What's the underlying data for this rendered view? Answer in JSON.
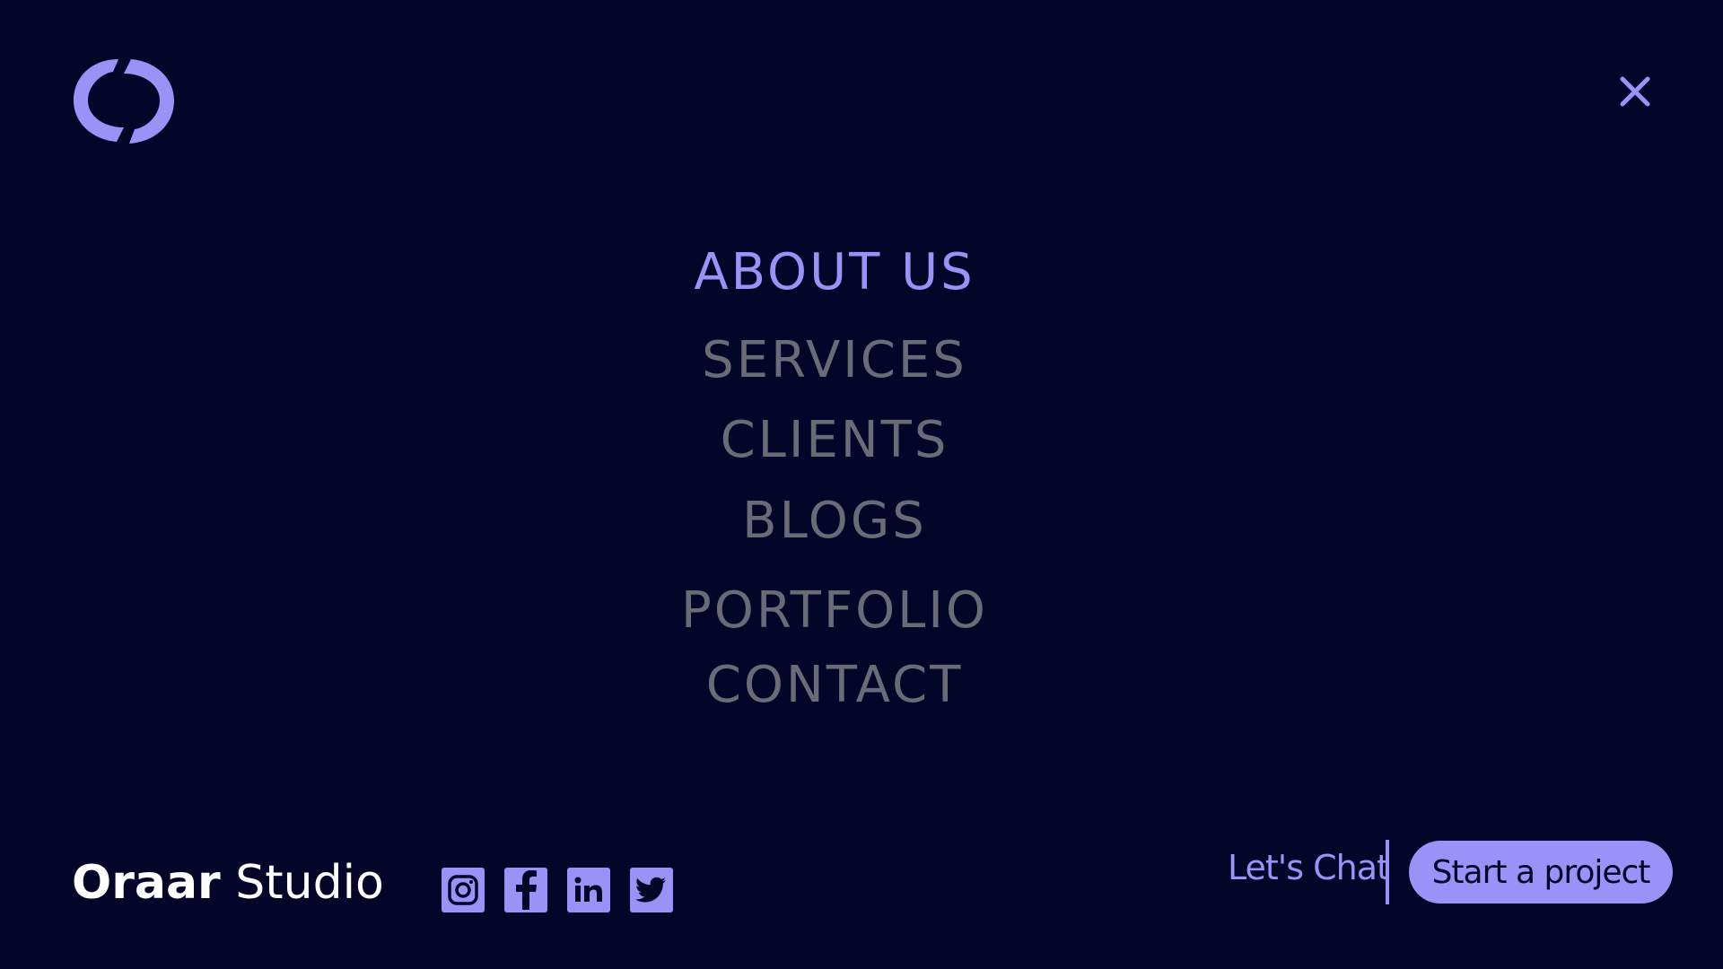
{
  "header": {
    "logo_icon": "swirl-circle-logo-icon",
    "close_icon": "close-icon"
  },
  "menu": {
    "items": [
      {
        "label": "ABOUT US",
        "active": true
      },
      {
        "label": "SERVICES",
        "active": false
      },
      {
        "label": "CLIENTS",
        "active": false
      },
      {
        "label": "BLOGS",
        "active": false
      },
      {
        "label": "PORTFOLIO",
        "active": false
      },
      {
        "label": "CONTACT",
        "active": false
      }
    ]
  },
  "footer": {
    "brand_bold": "Oraar",
    "brand_regular": "Studio",
    "socials": [
      {
        "name": "instagram-icon"
      },
      {
        "name": "facebook-icon"
      },
      {
        "name": "linkedin-icon"
      },
      {
        "name": "twitter-icon"
      }
    ],
    "lets_chat": "Let's Chat",
    "cta_label": "Start a project"
  },
  "colors": {
    "background": "#05052a",
    "accent": "#9a92f7",
    "muted_text": "#6b6b78",
    "white": "#ffffff"
  }
}
